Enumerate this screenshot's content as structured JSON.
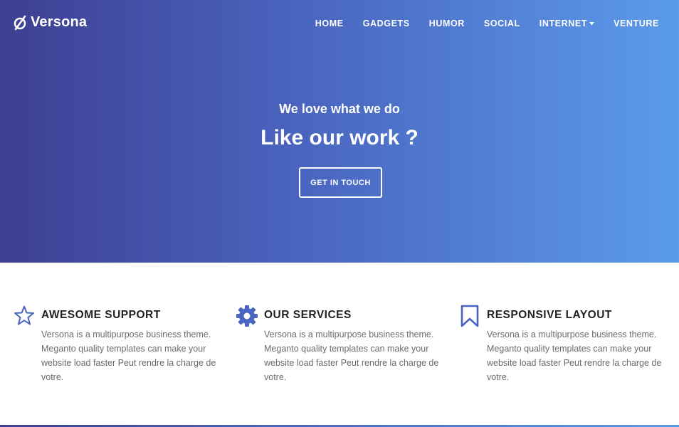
{
  "brand": {
    "name": "Versona",
    "logo_icon": "versona-logo-icon"
  },
  "nav": {
    "items": [
      {
        "label": "HOME"
      },
      {
        "label": "GADGETS"
      },
      {
        "label": "HUMOR"
      },
      {
        "label": "SOCIAL"
      },
      {
        "label": "INTERNET",
        "has_dropdown": true
      },
      {
        "label": "VENTURE"
      }
    ]
  },
  "hero": {
    "tagline": "We love what we do",
    "headline": "Like our work ?",
    "cta_label": "GET IN TOUCH",
    "gradient_start": "#3d3f92",
    "gradient_end": "#5b9beb"
  },
  "features": [
    {
      "icon": "star-icon",
      "title": "AWESOME SUPPORT",
      "text": "Versona is a multipurpose business theme. Meganto quality templates can make your website load faster Peut rendre la charge de votre."
    },
    {
      "icon": "gear-icon",
      "title": "OUR SERVICES",
      "text": "Versona is a multipurpose business theme. Meganto quality templates can make your website load faster Peut rendre la charge de votre."
    },
    {
      "icon": "bookmark-icon",
      "title": "RESPONSIVE LAYOUT",
      "text": "Versona is a multipurpose business theme. Meganto quality templates can make your website load faster Peut rendre la charge de votre."
    }
  ],
  "colors": {
    "accent": "#4a65c0",
    "heading": "#222222",
    "body_text": "#6b6b6b"
  }
}
